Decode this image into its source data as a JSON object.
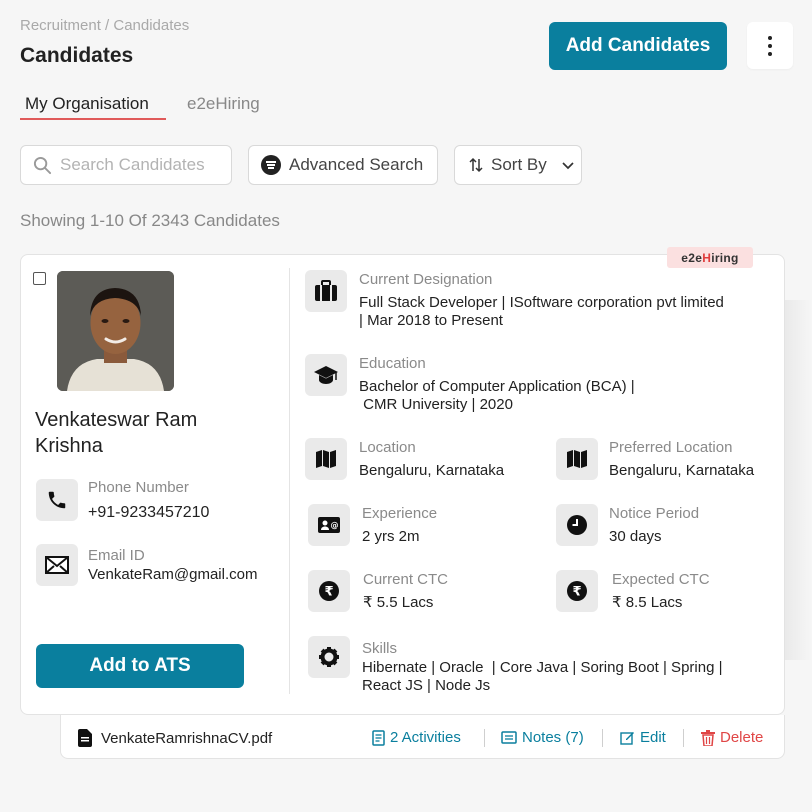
{
  "header": {
    "breadcrumb": "Recruitment / Candidates",
    "title": "Candidates",
    "add_button": "Add Candidates"
  },
  "tabs": [
    {
      "label": "My Organisation",
      "active": true
    },
    {
      "label": "e2eHiring",
      "active": false
    }
  ],
  "toolbar": {
    "search_placeholder": "Search Candidates",
    "advanced_search": "Advanced Search",
    "sort_by": "Sort By"
  },
  "summary": "Showing 1-10 Of 2343 Candidates",
  "candidate": {
    "tag_prefix": "e2e",
    "tag_highlight": "H",
    "tag_suffix": "iring",
    "name": "Venkateswar Ram Krishna",
    "phone_label": "Phone Number",
    "phone": "+91-9233457210",
    "email_label": "Email ID",
    "email": "VenkateRam@gmail.com",
    "add_to_ats": "Add to ATS",
    "designation_label": "Current Designation",
    "designation_line1": "Full Stack Developer | ISoftware corporation pvt limited",
    "designation_line2": "| Mar 2018 to Present",
    "education_label": "Education",
    "education_line1": "Bachelor of Computer Application (BCA) |",
    "education_line2": " CMR University | 2020",
    "location_label": "Location",
    "location": "Bengaluru, Karnataka",
    "pref_location_label": "Preferred Location",
    "pref_location": "Bengaluru, Karnataka",
    "experience_label": "Experience",
    "experience": "2 yrs 2m",
    "notice_label": "Notice Period",
    "notice": "30 days",
    "current_ctc_label": "Current CTC",
    "current_ctc": "₹ 5.5 Lacs",
    "expected_ctc_label": "Expected CTC",
    "expected_ctc": "₹ 8.5 Lacs",
    "skills_label": "Skills",
    "skills_line1": "Hibernate | Oracle  | Core Java | Soring Boot | Spring |",
    "skills_line2": "React JS | Node Js"
  },
  "footer": {
    "file": "VenkateRamrishnaCV.pdf",
    "activities": "2 Activities",
    "notes": "Notes (7)",
    "edit": "Edit",
    "delete": "Delete"
  },
  "colors": {
    "primary": "#0a7f9e",
    "tab_underline": "#e05a5a",
    "danger": "#e04646",
    "tag_bg": "#fbe0e0"
  }
}
